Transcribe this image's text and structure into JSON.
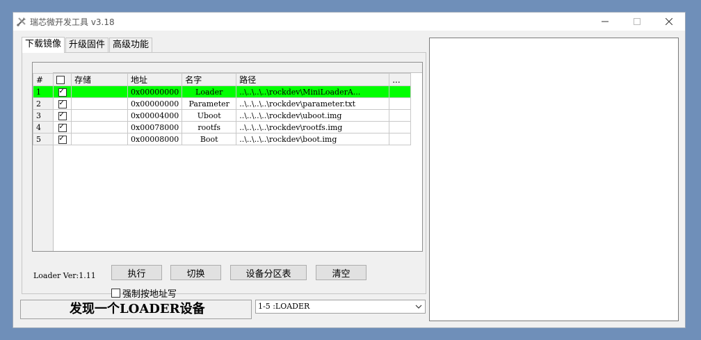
{
  "window": {
    "title": "瑞芯微开发工具 v3.18"
  },
  "tabs": [
    {
      "label": "下载镜像",
      "active": true
    },
    {
      "label": "升级固件",
      "active": false
    },
    {
      "label": "高级功能",
      "active": false
    }
  ],
  "grid": {
    "columns": [
      "#",
      "存储",
      "地址",
      "名字",
      "路径",
      "..."
    ],
    "rows": [
      {
        "num": "1",
        "checked": true,
        "storage": "",
        "address": "0x00000000",
        "name": "Loader",
        "path": "..\\..\\..\\..\\rockdev\\MiniLoaderA...",
        "highlight": true
      },
      {
        "num": "2",
        "checked": true,
        "storage": "",
        "address": "0x00000000",
        "name": "Parameter",
        "path": "..\\..\\..\\..\\rockdev\\parameter.txt",
        "highlight": false
      },
      {
        "num": "3",
        "checked": true,
        "storage": "",
        "address": "0x00004000",
        "name": "Uboot",
        "path": "..\\..\\..\\..\\rockdev\\uboot.img",
        "highlight": false
      },
      {
        "num": "4",
        "checked": true,
        "storage": "",
        "address": "0x00078000",
        "name": "rootfs",
        "path": "..\\..\\..\\..\\rockdev\\rootfs.img",
        "highlight": false
      },
      {
        "num": "5",
        "checked": true,
        "storage": "",
        "address": "0x00008000",
        "name": "Boot",
        "path": "..\\..\\..\\..\\rockdev\\boot.img",
        "highlight": false
      }
    ]
  },
  "loader_version": "Loader Ver:1.11",
  "buttons": {
    "run": "执行",
    "switch": "切换",
    "partition": "设备分区表",
    "clear": "清空"
  },
  "force_write_label": "强制按地址写",
  "status_text": "发现一个LOADER设备",
  "device_select": {
    "selected": "1-5 :LOADER"
  },
  "colors": {
    "highlight_row": "#00ff00",
    "window_bg": "#f0f0f0",
    "desktop": "#6f8fb9"
  }
}
